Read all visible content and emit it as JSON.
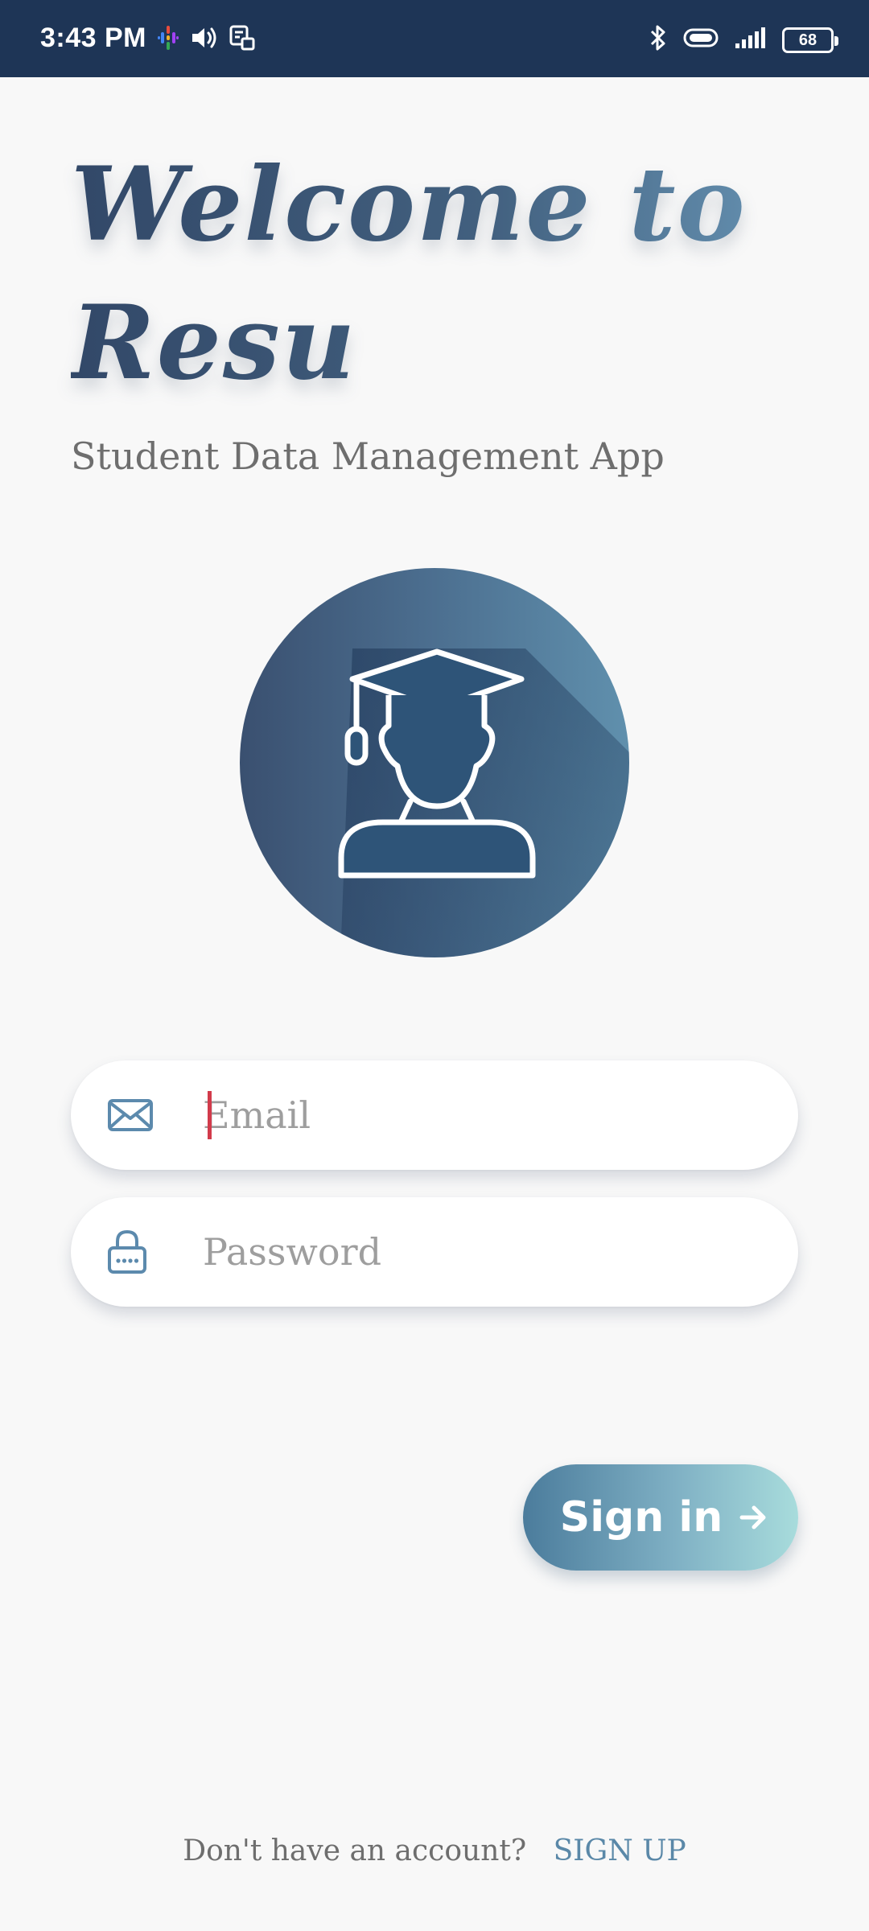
{
  "status_bar": {
    "time": "3:43 PM",
    "battery_level": "68",
    "icons": [
      "podcast-icon",
      "volume-icon",
      "notification-icon",
      "bluetooth-icon",
      "vibrate-icon",
      "signal-icon",
      "battery-icon"
    ]
  },
  "header": {
    "title": "Welcome to Resu",
    "subtitle": "Student Data Management App"
  },
  "logo": {
    "icon": "graduate-student-icon"
  },
  "form": {
    "email": {
      "value": "",
      "placeholder": "Email",
      "icon": "mail-icon"
    },
    "password": {
      "value": "",
      "placeholder": "Password",
      "icon": "lock-icon"
    },
    "signin_label": "Sign in",
    "signin_icon": "arrow-right-icon"
  },
  "footer": {
    "prompt": "Don't have an account?",
    "signup_label": "SIGN UP"
  },
  "colors": {
    "status_bar": "#1e3556",
    "accent": "#4b7c9c",
    "background": "#f8f8f8"
  }
}
